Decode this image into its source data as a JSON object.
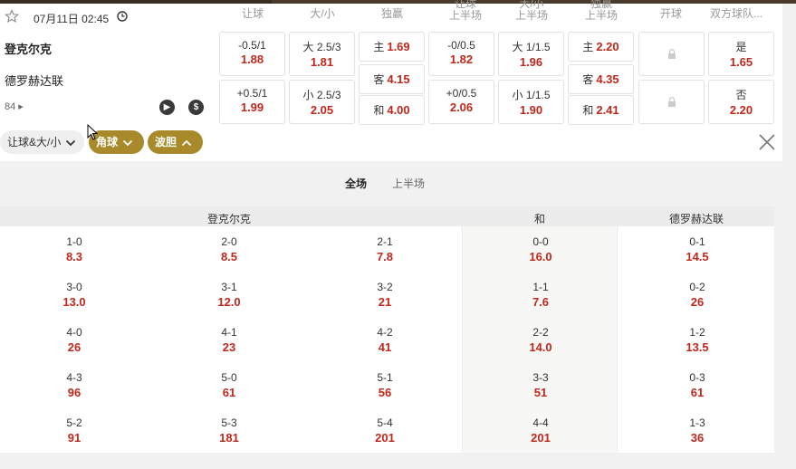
{
  "header": {
    "datetime": "07月11日 02:45",
    "columns": [
      {
        "label": "让球"
      },
      {
        "label": "大/小"
      },
      {
        "label": "独赢"
      },
      {
        "label": "让球\n上半场"
      },
      {
        "label": "大/小\n上半场"
      },
      {
        "label": "独赢\n上半场"
      },
      {
        "label": "开球"
      },
      {
        "label": "双方球队..."
      }
    ]
  },
  "match": {
    "team_home": "登克尔克",
    "team_away": "德罗赫达联",
    "minute": "84"
  },
  "odds": {
    "handicap": [
      {
        "label": "-0.5/1",
        "val": "1.88"
      },
      {
        "label": "+0.5/1",
        "val": "1.99"
      }
    ],
    "total": [
      {
        "label": "大 2.5/3",
        "val": "1.81"
      },
      {
        "label": "小 2.5/3",
        "val": "2.05"
      }
    ],
    "moneyline": [
      {
        "label": "主",
        "val": "1.69"
      },
      {
        "label": "客",
        "val": "4.15"
      },
      {
        "label": "和",
        "val": "4.00"
      }
    ],
    "handicap_1h": [
      {
        "label": "-0/0.5",
        "val": "1.82"
      },
      {
        "label": "+0/0.5",
        "val": "2.06"
      }
    ],
    "total_1h": [
      {
        "label": "大 1/1.5",
        "val": "1.96"
      },
      {
        "label": "小 1/1.5",
        "val": "1.90"
      }
    ],
    "moneyline_1h": [
      {
        "label": "主",
        "val": "2.20"
      },
      {
        "label": "客",
        "val": "4.35"
      },
      {
        "label": "和",
        "val": "2.41"
      }
    ],
    "btts": [
      {
        "label": "是",
        "val": "1.65"
      },
      {
        "label": "否",
        "val": "2.20"
      }
    ]
  },
  "filters": {
    "handicap_total": "让球&大/小",
    "corners": "角球",
    "correct_score": "波胆"
  },
  "tabs": {
    "full": "全场",
    "half": "上半场"
  },
  "grid_headers": {
    "home": "登克尔克",
    "draw": "和",
    "away": "德罗赫达联"
  },
  "scores": {
    "col1": [
      {
        "s": "1-0",
        "o": "8.3"
      },
      {
        "s": "3-0",
        "o": "13.0"
      },
      {
        "s": "4-0",
        "o": "26"
      },
      {
        "s": "4-3",
        "o": "96"
      },
      {
        "s": "5-2",
        "o": "91"
      }
    ],
    "col2": [
      {
        "s": "2-0",
        "o": "8.5"
      },
      {
        "s": "3-1",
        "o": "12.0"
      },
      {
        "s": "4-1",
        "o": "23"
      },
      {
        "s": "5-0",
        "o": "61"
      },
      {
        "s": "5-3",
        "o": "181"
      }
    ],
    "col3": [
      {
        "s": "2-1",
        "o": "7.8"
      },
      {
        "s": "3-2",
        "o": "21"
      },
      {
        "s": "4-2",
        "o": "41"
      },
      {
        "s": "5-1",
        "o": "56"
      },
      {
        "s": "5-4",
        "o": "201"
      }
    ],
    "col4": [
      {
        "s": "0-0",
        "o": "16.0"
      },
      {
        "s": "1-1",
        "o": "7.6"
      },
      {
        "s": "2-2",
        "o": "14.0"
      },
      {
        "s": "3-3",
        "o": "51"
      },
      {
        "s": "4-4",
        "o": "201"
      }
    ],
    "col5": [
      {
        "s": "0-1",
        "o": "14.5"
      },
      {
        "s": "0-2",
        "o": "26"
      },
      {
        "s": "1-2",
        "o": "13.5"
      },
      {
        "s": "0-3",
        "o": "61"
      },
      {
        "s": "1-3",
        "o": "36"
      }
    ]
  },
  "colors": {
    "accent_gold": "#a88a2a",
    "odd_red": "#c0281c"
  }
}
